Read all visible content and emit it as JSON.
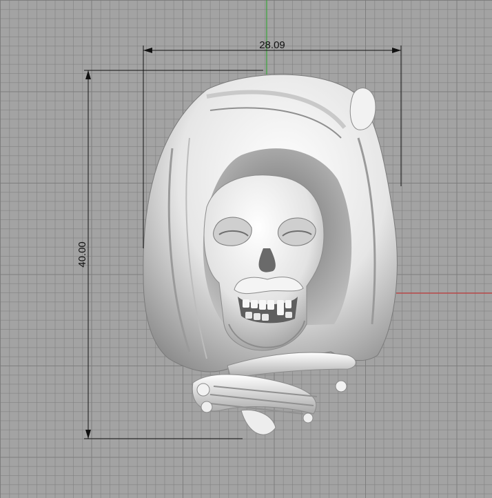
{
  "viewport": {
    "background_color": "#a3a3a3",
    "grid_color": "#8a8a8a",
    "x_axis_color": "#c23a3a",
    "y_axis_color": "#3aa63a"
  },
  "dimensions": {
    "width_label": "28.09",
    "height_label": "40.00"
  },
  "model": {
    "object": "skull-pendant-relief",
    "color": "#ededed"
  }
}
